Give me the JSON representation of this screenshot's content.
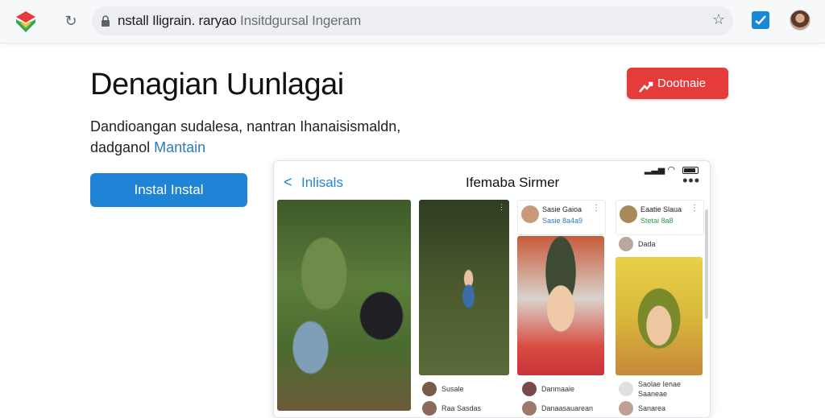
{
  "browser": {
    "url_main": "nstall Iligrain. raryao",
    "url_rest": " Insitdgursal Ingeram",
    "reload_glyph": "↻",
    "star_glyph": "☆",
    "icons": [
      "app-logo-icon",
      "reload-icon",
      "lock-icon",
      "bookmark-star-icon",
      "extension-icon",
      "profile-avatar"
    ]
  },
  "hero": {
    "title": "Denagian Uunlagai",
    "desc_line1": "Dandioangan sudalesa, nantran Ihanaisismaldn,",
    "desc_line2_prefix": "dadganol ",
    "desc_line2_link": "Mantain",
    "install_label": "Instal Instal",
    "download_label": "Dootnaie"
  },
  "preview": {
    "back_glyph": "<",
    "back_label": "Inlisals",
    "title": "Ifemaba Sirmer",
    "more_glyph": "•••",
    "photo_dots": "⋮",
    "cards": {
      "c1": {
        "name": "Sasie Gaioa",
        "meta": "Sasie 8a4a9",
        "menu": "⋮"
      },
      "c2": {
        "name": "Eaatie Slaua",
        "meta": "Stetai 8a8",
        "menu": "⋮",
        "sub": "Dada"
      },
      "left_bottom": [
        {
          "label": "Susale"
        },
        {
          "label": "Raa Sasdas"
        }
      ],
      "mid_bottom": [
        {
          "label": "Danmaaie"
        },
        {
          "label": "Danaasauarean"
        }
      ],
      "right_bottom": [
        {
          "label": "Saolae Ienae"
        },
        {
          "label": "Saaneae"
        },
        {
          "label": "Sanarea"
        }
      ]
    }
  },
  "colors": {
    "install_button": "#1f84d6",
    "download_button": "#e53b3b",
    "link": "#2a7bbf"
  }
}
